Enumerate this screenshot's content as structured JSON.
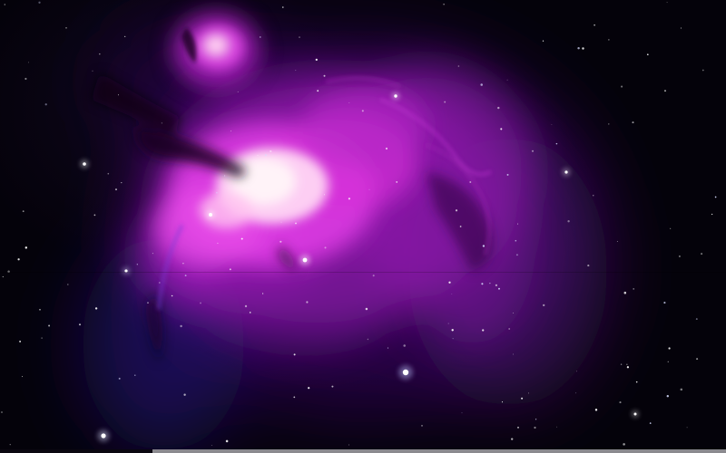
{
  "image": {
    "subject": "",
    "colors": {
      "background": "#04020a",
      "nebula_core": "#fff3f8",
      "nebula_pink": "#e23ce6",
      "nebula_magenta": "#b020c8",
      "nebula_violet": "#5a1290",
      "nebula_deep": "#2a0850",
      "dust_dark": "#1a0620",
      "star_white": "#ffffff",
      "star_blue": "#bfc8ff"
    }
  }
}
